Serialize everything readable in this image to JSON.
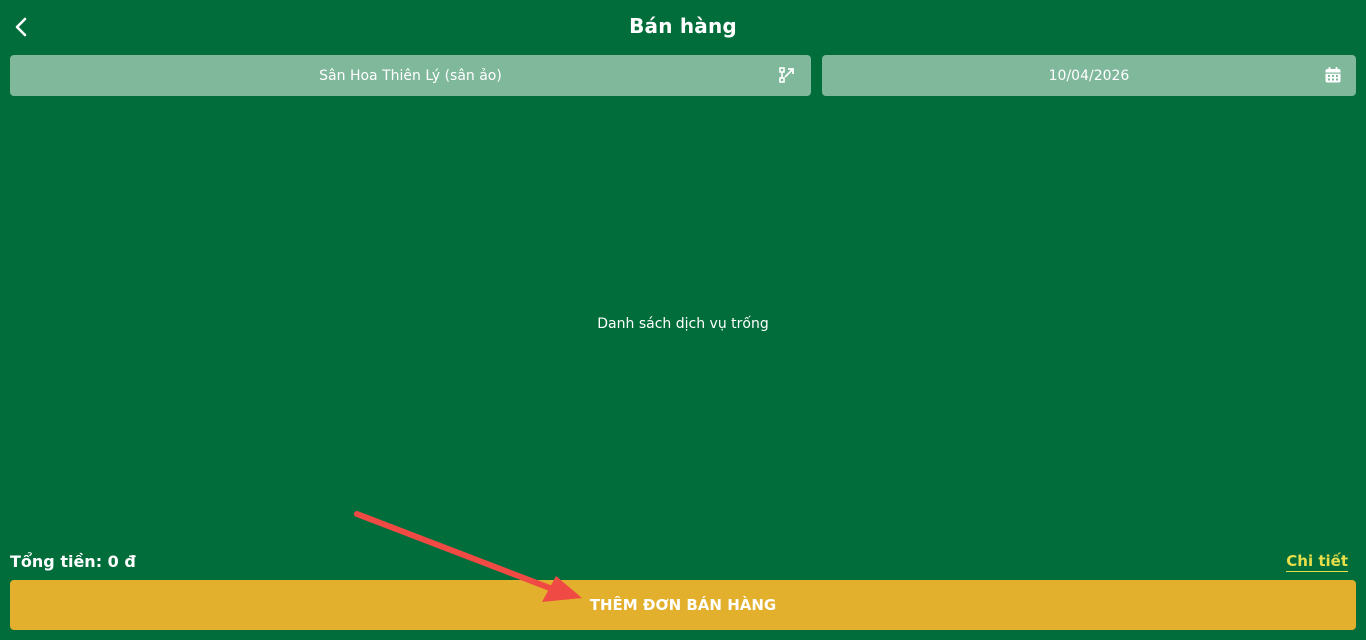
{
  "header": {
    "title": "Bán hàng",
    "back_icon": "chevron-left-icon"
  },
  "filters": {
    "venue": "Sân Hoa Thiên Lý (sân ảo)",
    "venue_icon": "route-switch-icon",
    "date": "10/04/2026",
    "date_icon": "calendar-icon"
  },
  "main": {
    "empty_message": "Danh sách dịch vụ trống"
  },
  "footer": {
    "total_label": "Tổng tiền: 0 đ",
    "detail_link": "Chi tiết",
    "add_order_button": "THÊM ĐƠN BÁN HÀNG"
  },
  "colors": {
    "background": "#006d3a",
    "selector_bg": "#80b89c",
    "button_bg": "#e2b02c",
    "link_color": "#e8df4a",
    "annotation_arrow": "#f04a45"
  }
}
